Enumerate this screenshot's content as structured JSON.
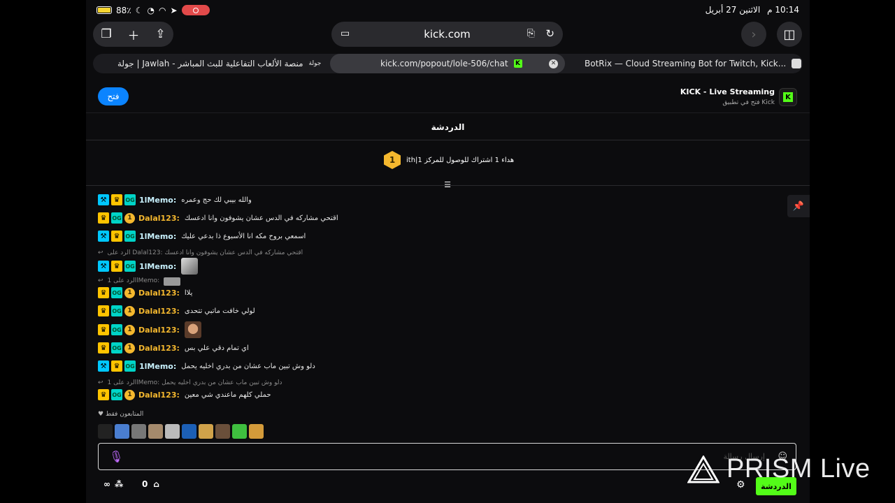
{
  "status": {
    "battery": "88٪",
    "time": "10:14 م",
    "date": "الاثنين 27 أبريل"
  },
  "browser": {
    "url": "kick.com",
    "tabs": [
      {
        "title": "جولة | Jawlah - منصة الألعاب التفاعلية للبث المباشر",
        "favicon": "جولة"
      },
      {
        "title": "kick.com/popout/lole-506/chat",
        "active": true
      },
      {
        "title": "BotRix — Cloud Streaming Bot for Twitch, Kick..."
      }
    ]
  },
  "banner": {
    "open_label": "فتح",
    "app_title": "KICK - Live Streaming",
    "app_subtitle": "فتح في تطبيق Kick"
  },
  "chat": {
    "header": "الدردشة",
    "goal_text": "ith|هداء 1 اشتراك للوصول للمركز 1",
    "goal_rank": "1",
    "messages": [
      {
        "user": "1lMemo:",
        "text": "والله بيبي لك حج وعمره",
        "type": "memo"
      },
      {
        "user": "Dalal123:",
        "text": "اقتحي مشاركه في الدس عشان يشوفون وانا ادعسك",
        "type": "dalal"
      },
      {
        "user": "1lMemo:",
        "text": "اسمعي بروح مكه انا الأسبوع ذا بدعي عليك",
        "type": "memo"
      },
      {
        "user": "1lMemo:",
        "text": "",
        "type": "memo",
        "emote": true
      },
      {
        "user": "Dalal123:",
        "text": "يلاا",
        "type": "dalal"
      },
      {
        "user": "Dalal123:",
        "text": "لولي خافت ماتبي تتحدى",
        "type": "dalal"
      },
      {
        "user": "Dalal123:",
        "text": "",
        "type": "dalal",
        "emote": true
      },
      {
        "user": "Dalal123:",
        "text": "اي تمام دقي علي بس",
        "type": "dalal"
      },
      {
        "user": "1lMemo:",
        "text": "دلو وش تبين ماب عشان من بدري اخليه يحمل",
        "type": "memo"
      },
      {
        "user": "Dalal123:",
        "text": "حملي كلهم ماعندي شي معين",
        "type": "dalal"
      }
    ],
    "replies": [
      "الرد على Dalal123: اقتحي مشاركه في الدس عشان يشوفون وانا ادعسك",
      "الرد على 1lMemo:",
      "الرد على 1lMemo: دلو وش تبين ماب عشان من بدري اخليه يحمل"
    ],
    "followers_only": "المتابعون فقط",
    "input_placeholder": "إرسال رسالة",
    "points": "∞",
    "zero": "0",
    "chat_button": "الدردشة"
  },
  "watermark": "PRISM Live",
  "colors": {
    "kick_green": "#53fc18",
    "open_blue": "#0b84ff",
    "sub_gold": "#f5b82e"
  }
}
